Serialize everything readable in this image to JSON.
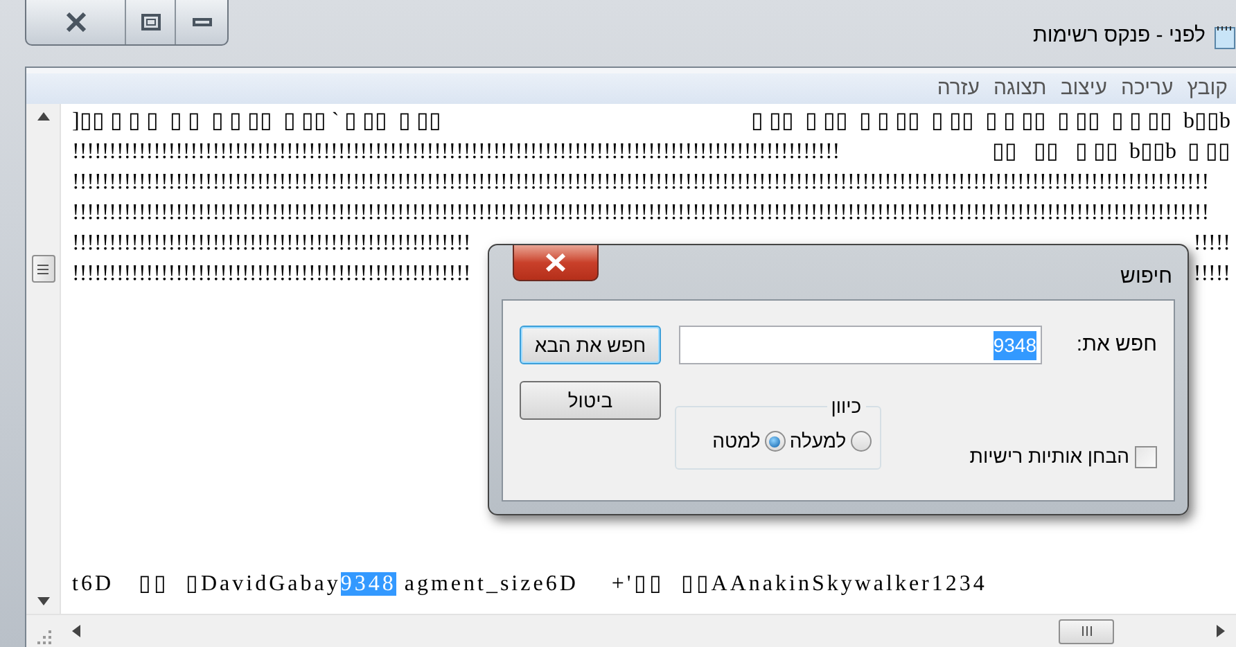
{
  "window": {
    "title": "לפני - פנקס רשימות"
  },
  "menu": [
    {
      "label": "קובץ"
    },
    {
      "label": "עריכה"
    },
    {
      "label": "עיצוב"
    },
    {
      "label": "תצוגה"
    },
    {
      "label": "עזרה"
    }
  ],
  "editor": {
    "lines": [
      {
        "left": "]▯▯ ▯ ▯ ▯  ▯ ▯  ▯ ▯ ▯▯  ▯ ▯▯ ` ▯ ▯▯  ▯ ▯▯",
        "right": "▯ ▯▯  ▯ ▯▯  ▯ ▯ ▯▯  ▯ ▯▯  ▯ ▯ ▯▯  ▯ ▯▯  ▯ ▯ ▯▯  b▯▯b"
      },
      {
        "left": "!!!!!!!!!!!!!!!!!!!!!!!!!!!!!!!!!!!!!!!!!!!!!!!!!!!!!!!!!!!!!!!!!!!!!!!!!!!!!!!!!!!!!!!!!!!!!!!!!!!!!!!!",
        "right": "▯▯   ▯▯   ▯ ▯▯  b▯▯b  ▯ ▯▯"
      },
      {
        "left": "!!!!!!!!!!!!!!!!!!!!!!!!!!!!!!!!!!!!!!!!!!!!!!!!!!!!!!!!!!!!!!!!!!!!!!!!!!!!!!!!!!!!!!!!!!!!!!!!!!!!!!!!!!!!!!!!!!!!!!!!!!!!!!!!!!!!!!!!!!!!!!!!!!!!!!!!!!"
      },
      {
        "left": "!!!!!!!!!!!!!!!!!!!!!!!!!!!!!!!!!!!!!!!!!!!!!!!!!!!!!!!!!!!!!!!!!!!!!!!!!!!!!!!!!!!!!!!!!!!!!!!!!!!!!!!!!!!!!!!!!!!!!!!!!!!!!!!!!!!!!!!!!!!!!!!!!!!!!!!!!!"
      },
      {
        "left": "!!!!!!!!!!!!!!!!!!!!!!!!!!!!!!!!!!!!!!!!!!!!!!!!!!!!!!",
        "right": "!!!!!"
      },
      {
        "left": "!!!!!!!!!!!!!!!!!!!!!!!!!!!!!!!!!!!!!!!!!!!!!!!!!!!!!!",
        "right": "!!!!!"
      }
    ],
    "last_line": {
      "before": "t6D   ▯▯  ▯DavidGabay",
      "selected": "9348",
      "after": " agment_size6D    +'▯▯  ▯▯AAnakinSkywalker1234"
    }
  },
  "find_dialog": {
    "title": "חיפוש",
    "find_label": "חפש את:",
    "find_value": "9348",
    "buttons": [
      {
        "label": "חפש את הבא",
        "focused": true
      },
      {
        "label": "ביטול",
        "focused": false
      }
    ],
    "direction": {
      "legend": "כיוון",
      "options": [
        {
          "label": "למעלה",
          "selected": false
        },
        {
          "label": "למטה",
          "selected": true
        }
      ]
    },
    "match_case": {
      "label": "הבחן אותיות רישיות",
      "checked": false
    }
  }
}
